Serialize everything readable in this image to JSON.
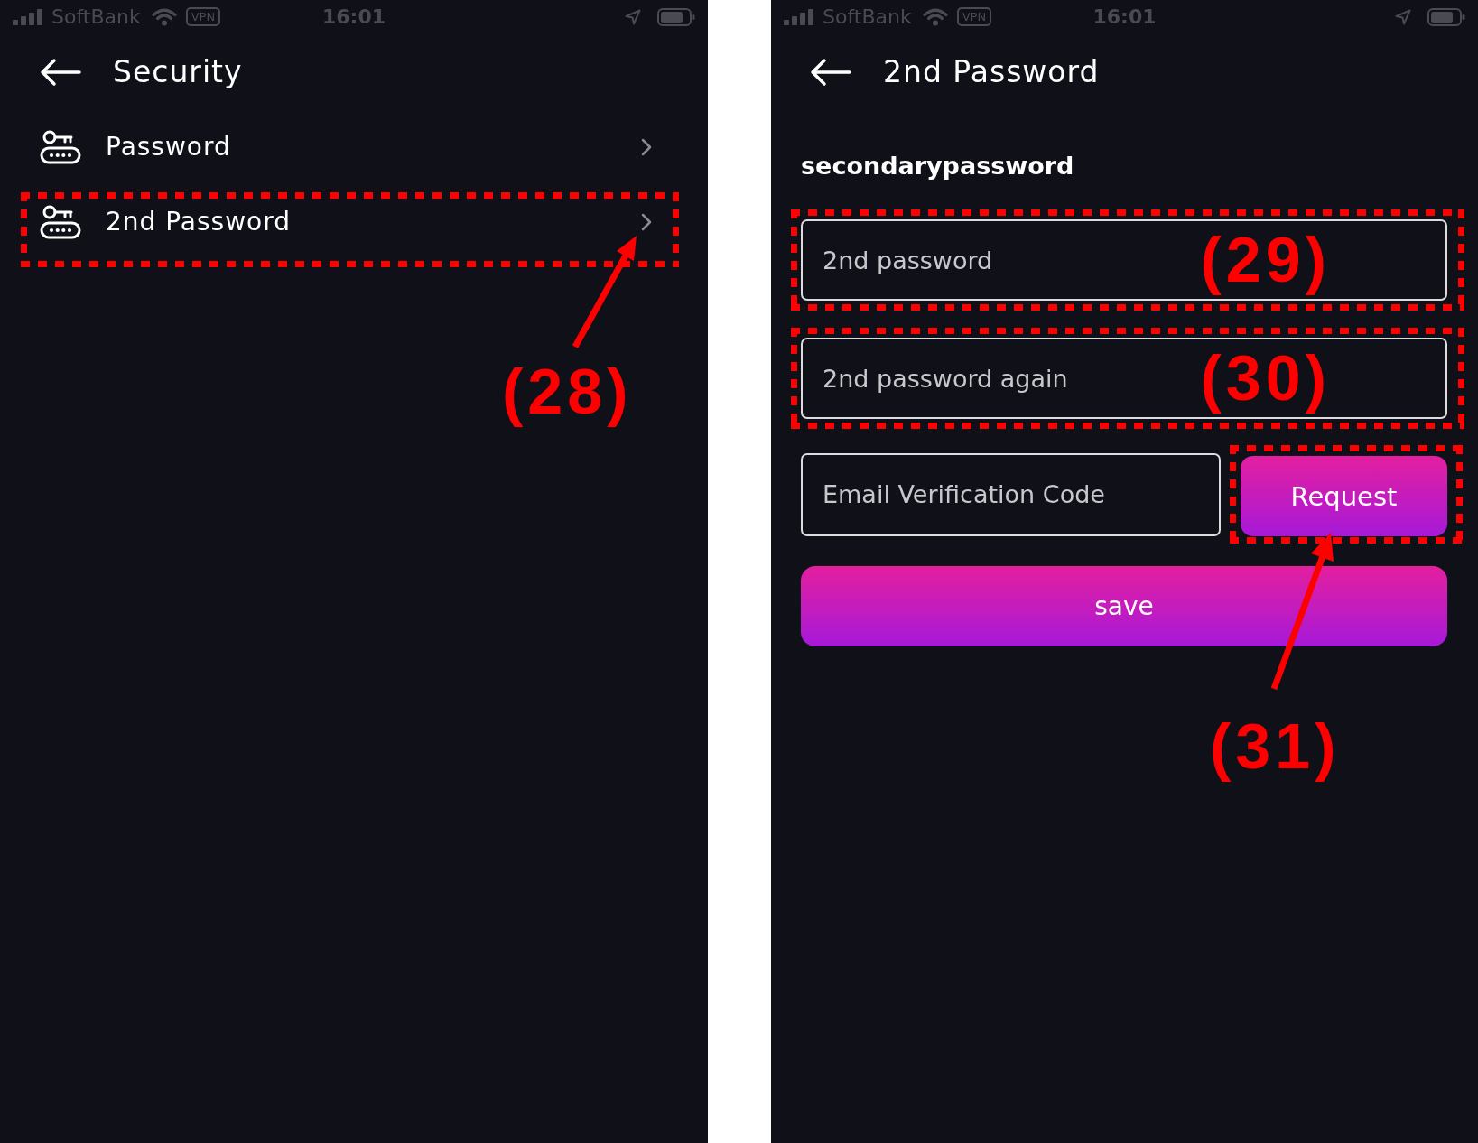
{
  "security_screen": {
    "status_bar": {
      "carrier": "SoftBank",
      "vpn": "VPN",
      "time": "16:01"
    },
    "title": "Security",
    "menu_items": [
      {
        "label": "Password",
        "marked": false
      },
      {
        "label": "2nd Password",
        "marked": true,
        "callout": "(28)"
      }
    ]
  },
  "second_password_screen": {
    "status_bar": {
      "carrier": "SoftBank",
      "vpn": "VPN",
      "time": "16:01"
    },
    "title": "2nd Password",
    "section_label": "secondarypassword",
    "fields": [
      {
        "placeholder": "2nd password",
        "marked": true,
        "callout": "(29)"
      },
      {
        "placeholder": "2nd password again",
        "marked": true,
        "callout": "(30)"
      }
    ],
    "code_field": {
      "placeholder": "Email Verification Code"
    },
    "request_button": {
      "label": "Request",
      "marked": true,
      "callout": "(31)"
    },
    "save_button": {
      "label": "save"
    }
  }
}
